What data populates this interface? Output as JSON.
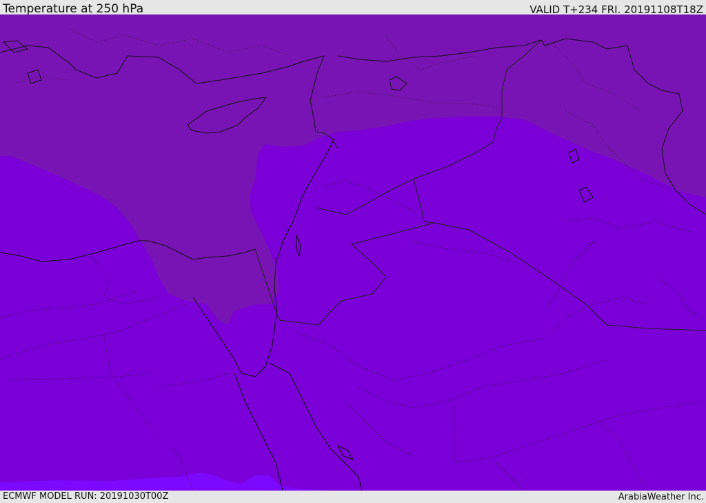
{
  "header": {
    "title": "Temperature at 250 hPa",
    "valid": "VALID T+234 FRI. 20191108T18Z"
  },
  "footer": {
    "model_run": "ECMWF MODEL RUN: 20191030T00Z",
    "credit": "ArabiaWeather Inc."
  },
  "colors": {
    "base_fill": "#7b00d8",
    "warm_region": "#7914b4",
    "cool_band": "#7d08ff",
    "coastline": "#111111",
    "border": "#222222"
  }
}
